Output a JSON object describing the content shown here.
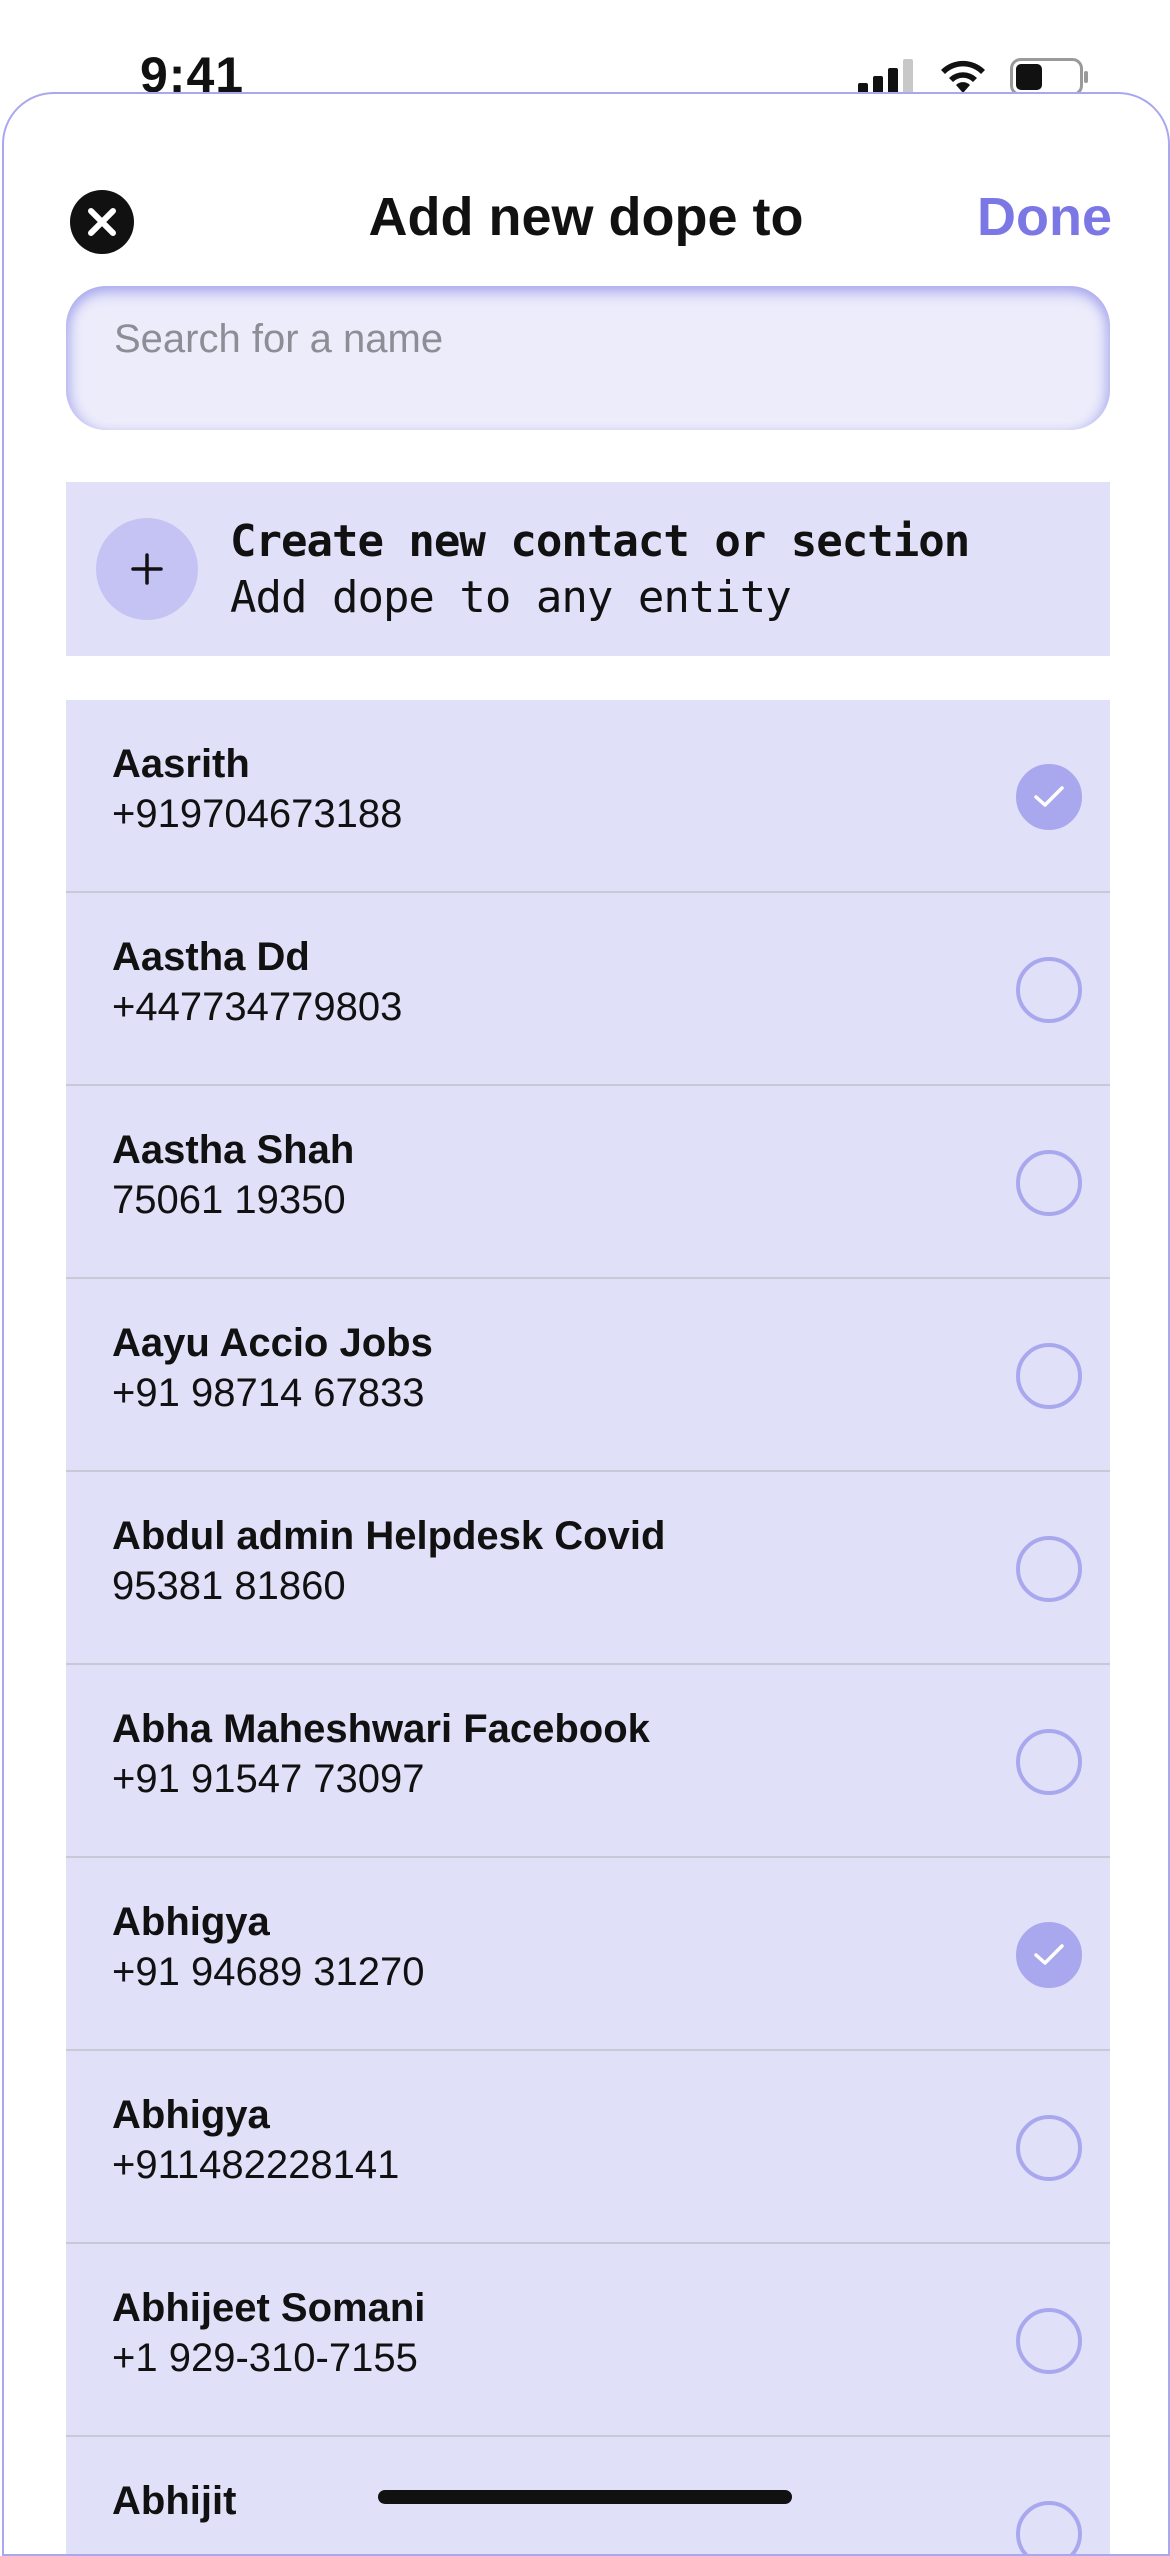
{
  "status_bar": {
    "time": "9:41",
    "icons": [
      "signal-icon",
      "wifi-icon",
      "battery-icon"
    ]
  },
  "header": {
    "close_icon": "close-icon",
    "title": "Add new dope to",
    "done_label": "Done"
  },
  "search": {
    "placeholder": "Search for a name",
    "value": ""
  },
  "create": {
    "icon": "plus-icon",
    "title": "Create new contact or section",
    "subtitle": "Add dope to any entity"
  },
  "contacts": [
    {
      "name": "Aasrith",
      "phone": "+919704673188",
      "selected": true
    },
    {
      "name": "Aastha Dd",
      "phone": "+447734779803",
      "selected": false
    },
    {
      "name": "Aastha Shah",
      "phone": "75061 19350",
      "selected": false
    },
    {
      "name": "Aayu Accio Jobs",
      "phone": "+91 98714 67833",
      "selected": false
    },
    {
      "name": "Abdul admin Helpdesk Covid",
      "phone": "95381 81860",
      "selected": false
    },
    {
      "name": "Abha Maheshwari Facebook",
      "phone": "+91 91547 73097",
      "selected": false
    },
    {
      "name": "Abhigya",
      "phone": "+91 94689 31270",
      "selected": true
    },
    {
      "name": "Abhigya",
      "phone": "+911482228141",
      "selected": false
    },
    {
      "name": "Abhijeet Somani",
      "phone": "+1 929-310-7155",
      "selected": false
    },
    {
      "name": "Abhijit",
      "phone": "",
      "selected": false
    }
  ],
  "colors": {
    "accent": "#7b78e6",
    "row_bg": "#e1e0f9",
    "check_on": "#a9a8ee"
  }
}
